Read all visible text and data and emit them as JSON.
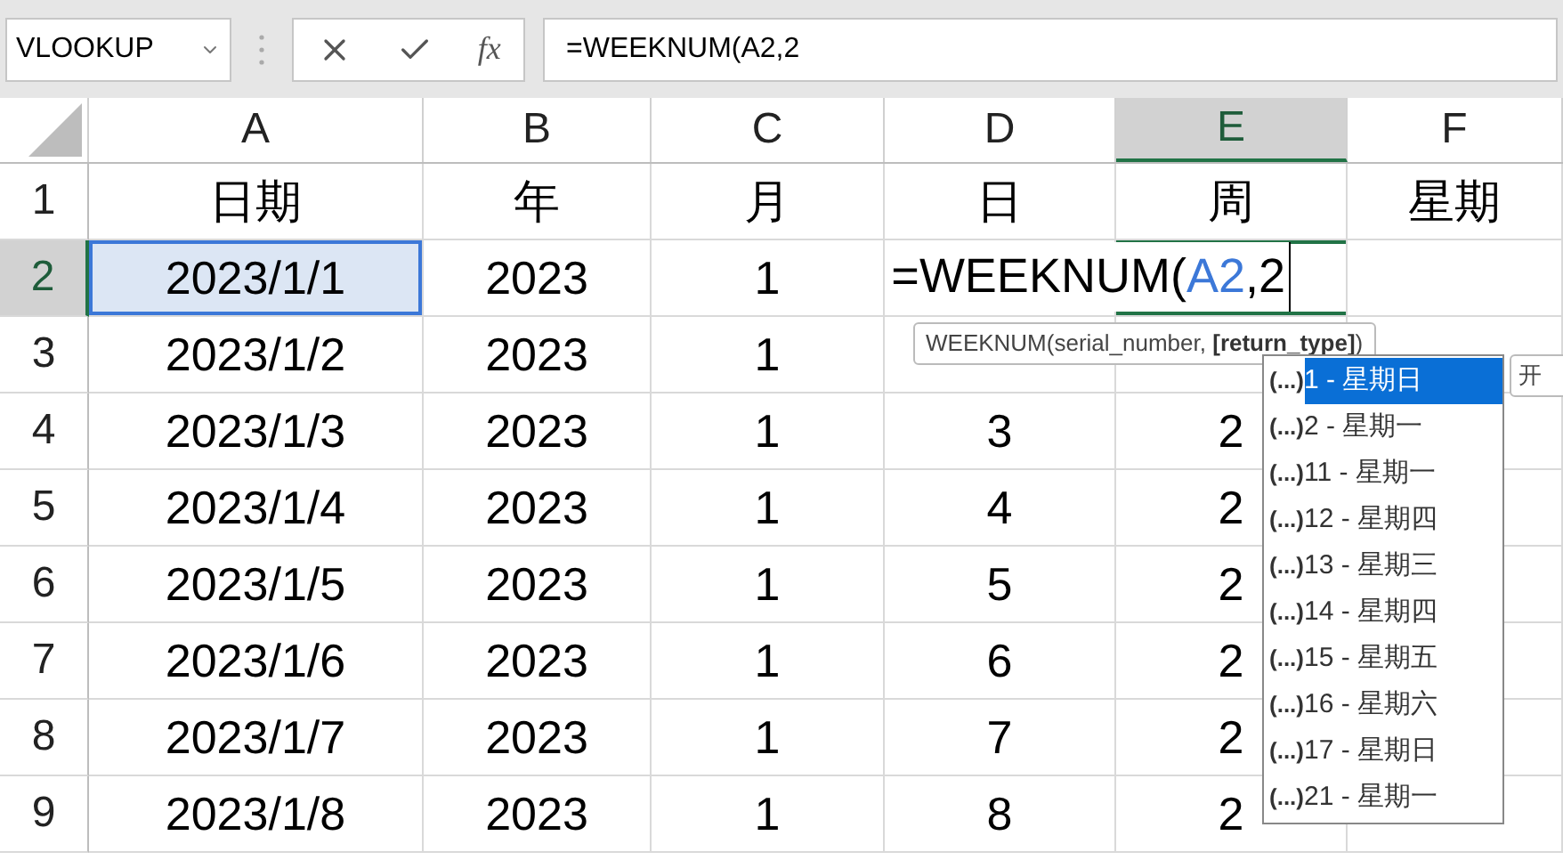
{
  "name_box": {
    "value": "VLOOKUP"
  },
  "formula_bar": {
    "fx": "fx",
    "value": "=WEEKNUM(A2,2"
  },
  "columns": [
    {
      "label": "A",
      "selected": false
    },
    {
      "label": "B",
      "selected": false
    },
    {
      "label": "C",
      "selected": false
    },
    {
      "label": "D",
      "selected": false
    },
    {
      "label": "E",
      "selected": true
    },
    {
      "label": "F",
      "selected": false
    }
  ],
  "rows": [
    {
      "header": "1",
      "selected": false,
      "cells": [
        {
          "kind": "value",
          "text": "日期"
        },
        {
          "kind": "value",
          "text": "年"
        },
        {
          "kind": "value",
          "text": "月"
        },
        {
          "kind": "value",
          "text": "日"
        },
        {
          "kind": "value",
          "text": "周"
        },
        {
          "kind": "value",
          "text": "星期"
        }
      ]
    },
    {
      "header": "2",
      "selected": true,
      "cells": [
        {
          "kind": "reference",
          "text": "2023/1/1"
        },
        {
          "kind": "value",
          "text": "2023"
        },
        {
          "kind": "value",
          "text": "1"
        },
        {
          "kind": "blank"
        },
        {
          "kind": "editing",
          "parts": [
            {
              "kind": "text",
              "text": "=WEEKNUM("
            },
            {
              "kind": "ref",
              "text": "A2"
            },
            {
              "kind": "text",
              "text": ",2"
            }
          ]
        },
        {
          "kind": "blank"
        }
      ]
    },
    {
      "header": "3",
      "selected": false,
      "cells": [
        {
          "kind": "value",
          "text": "2023/1/2"
        },
        {
          "kind": "value",
          "text": "2023"
        },
        {
          "kind": "value",
          "text": "1"
        },
        {
          "kind": "blank"
        },
        {
          "kind": "blank"
        },
        {
          "kind": "blank"
        }
      ]
    },
    {
      "header": "4",
      "selected": false,
      "cells": [
        {
          "kind": "value",
          "text": "2023/1/3"
        },
        {
          "kind": "value",
          "text": "2023"
        },
        {
          "kind": "value",
          "text": "1"
        },
        {
          "kind": "value",
          "text": "3"
        },
        {
          "kind": "value",
          "text": "2"
        },
        {
          "kind": "blank"
        }
      ]
    },
    {
      "header": "5",
      "selected": false,
      "cells": [
        {
          "kind": "value",
          "text": "2023/1/4"
        },
        {
          "kind": "value",
          "text": "2023"
        },
        {
          "kind": "value",
          "text": "1"
        },
        {
          "kind": "value",
          "text": "4"
        },
        {
          "kind": "value",
          "text": "2"
        },
        {
          "kind": "blank"
        }
      ]
    },
    {
      "header": "6",
      "selected": false,
      "cells": [
        {
          "kind": "value",
          "text": "2023/1/5"
        },
        {
          "kind": "value",
          "text": "2023"
        },
        {
          "kind": "value",
          "text": "1"
        },
        {
          "kind": "value",
          "text": "5"
        },
        {
          "kind": "value",
          "text": "2"
        },
        {
          "kind": "blank"
        }
      ]
    },
    {
      "header": "7",
      "selected": false,
      "cells": [
        {
          "kind": "value",
          "text": "2023/1/6"
        },
        {
          "kind": "value",
          "text": "2023"
        },
        {
          "kind": "value",
          "text": "1"
        },
        {
          "kind": "value",
          "text": "6"
        },
        {
          "kind": "value",
          "text": "2"
        },
        {
          "kind": "blank"
        }
      ]
    },
    {
      "header": "8",
      "selected": false,
      "cells": [
        {
          "kind": "value",
          "text": "2023/1/7"
        },
        {
          "kind": "value",
          "text": "2023"
        },
        {
          "kind": "value",
          "text": "1"
        },
        {
          "kind": "value",
          "text": "7"
        },
        {
          "kind": "value",
          "text": "2"
        },
        {
          "kind": "blank"
        }
      ]
    },
    {
      "header": "9",
      "selected": false,
      "cells": [
        {
          "kind": "value",
          "text": "2023/1/8"
        },
        {
          "kind": "value",
          "text": "2023"
        },
        {
          "kind": "value",
          "text": "1"
        },
        {
          "kind": "value",
          "text": "8"
        },
        {
          "kind": "value",
          "text": "2"
        },
        {
          "kind": "blank"
        }
      ]
    }
  ],
  "tooltip": {
    "before": "WEEKNUM(serial_number, ",
    "current": "[return_type]",
    "after": ")"
  },
  "autocomplete": [
    {
      "icon": "(...)",
      "label": "1 - 星期日",
      "selected": true
    },
    {
      "icon": "(...)",
      "label": "2 - 星期一",
      "selected": false
    },
    {
      "icon": "(...)",
      "label": "11 - 星期一",
      "selected": false
    },
    {
      "icon": "(...)",
      "label": "12 - 星期四",
      "selected": false
    },
    {
      "icon": "(...)",
      "label": "13 - 星期三",
      "selected": false
    },
    {
      "icon": "(...)",
      "label": "14 - 星期四",
      "selected": false
    },
    {
      "icon": "(...)",
      "label": "15 - 星期五",
      "selected": false
    },
    {
      "icon": "(...)",
      "label": "16 - 星期六",
      "selected": false
    },
    {
      "icon": "(...)",
      "label": "17 - 星期日",
      "selected": false
    },
    {
      "icon": "(...)",
      "label": "21 - 星期一",
      "selected": false
    }
  ],
  "side_tip": {
    "text": "开"
  }
}
